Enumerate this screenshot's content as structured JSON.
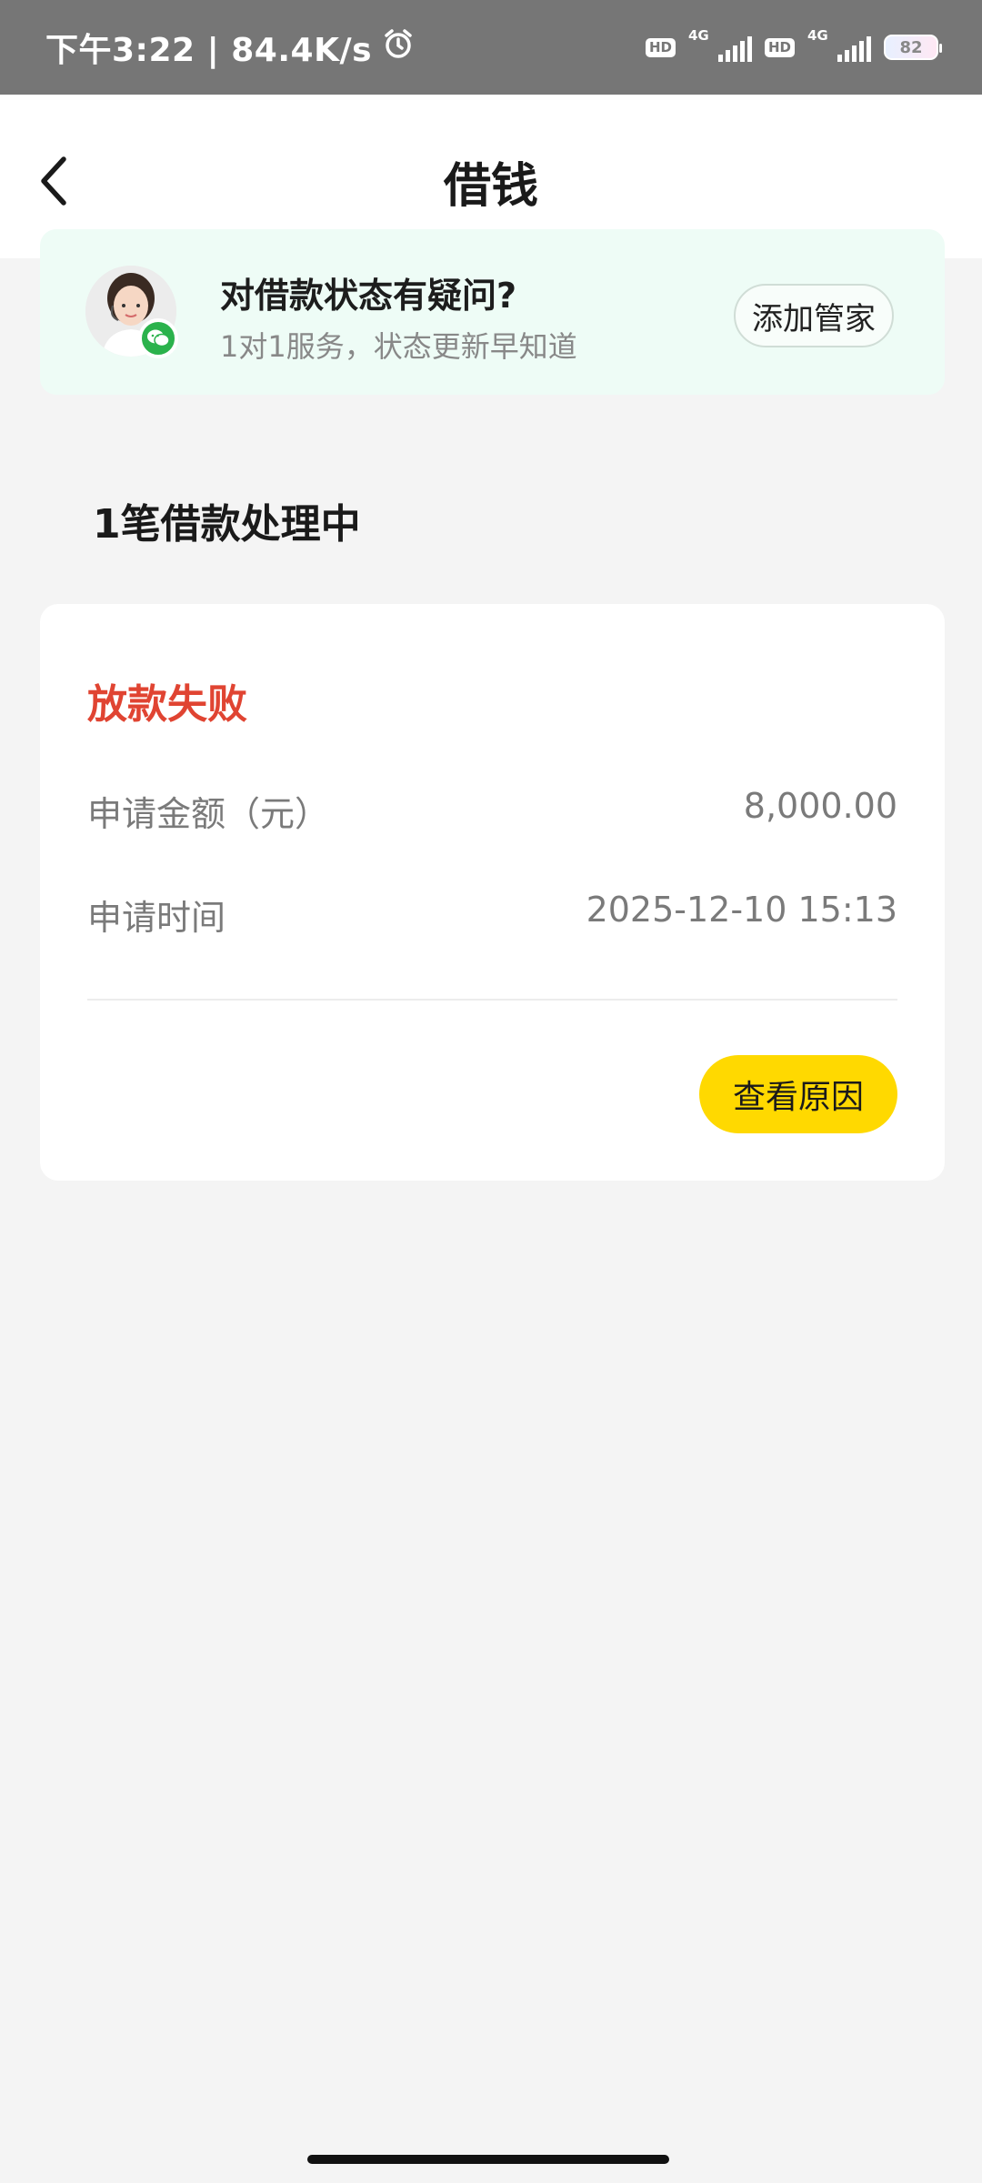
{
  "status_bar": {
    "time_speed": "下午3:22 | 84.4K/s",
    "sim1_hd": "HD",
    "sim1_net": "4G",
    "sim2_hd": "HD",
    "sim2_net": "4G",
    "battery": "82",
    "icons": [
      "alarm-icon",
      "signal-icon",
      "battery-icon"
    ]
  },
  "nav": {
    "title": "借钱",
    "back_icon": "chevron-left-icon"
  },
  "banner": {
    "title": "对借款状态有疑问?",
    "subtitle": "1对1服务，状态更新早知道",
    "button": "添加管家",
    "avatar_icon": "agent-avatar",
    "badge_icon": "wechat-icon"
  },
  "section": {
    "title": "1笔借款处理中"
  },
  "loan_card": {
    "status": "放款失败",
    "status_color": "#e04432",
    "rows": [
      {
        "label": "申请金额（元）",
        "value": "8,000.00"
      },
      {
        "label": "申请时间",
        "value": "2025-12-10 15:13"
      }
    ],
    "button": "查看原因",
    "button_color": "#ffd900"
  }
}
